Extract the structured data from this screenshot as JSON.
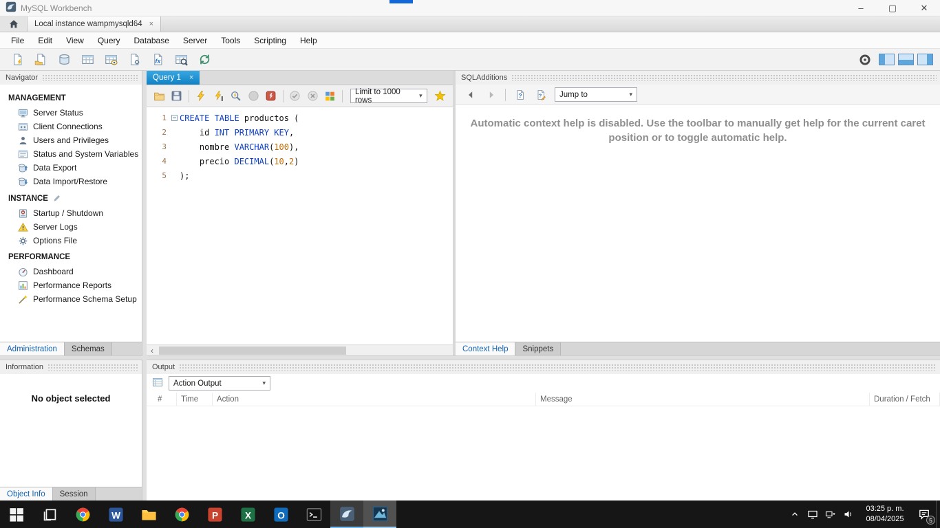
{
  "colors": {
    "query_tab_blue": "#1b86c8",
    "keyword_blue": "#0c3fc4",
    "number_orange": "#c06a00",
    "taskbar_dark": "#161616",
    "active_tab_text_blue": "#1464b4"
  },
  "titlebar": {
    "title": "MySQL Workbench",
    "minimize": "–",
    "maximize": "▢",
    "close": "✕"
  },
  "connection_bar": {
    "tab_label": "Local instance wampmysqld64",
    "tab_close": "×"
  },
  "menu": {
    "items": [
      "File",
      "Edit",
      "View",
      "Query",
      "Database",
      "Server",
      "Tools",
      "Scripting",
      "Help"
    ]
  },
  "main_toolbar": {
    "left_items": [
      "new-sql-tab",
      "open-sql-script",
      "create-schema",
      "create-table",
      "create-view",
      "create-procedure",
      "create-function",
      "search-table-data",
      "reconnect-dbms"
    ],
    "right_status_icon": "connection-status",
    "panel_toggles": [
      "toggle-left-sidebar",
      "toggle-output-area",
      "toggle-secondary-sidebar"
    ]
  },
  "navigator": {
    "header": "Navigator",
    "sections": [
      {
        "title": "MANAGEMENT",
        "items": [
          {
            "label": "Server Status",
            "icon": "server-status"
          },
          {
            "label": "Client Connections",
            "icon": "client-connections"
          },
          {
            "label": "Users and Privileges",
            "icon": "users-privileges"
          },
          {
            "label": "Status and System Variables",
            "icon": "system-variables"
          },
          {
            "label": "Data Export",
            "icon": "data-export"
          },
          {
            "label": "Data Import/Restore",
            "icon": "data-import"
          }
        ]
      },
      {
        "title": "INSTANCE",
        "title_icon": "instance-edit",
        "items": [
          {
            "label": "Startup / Shutdown",
            "icon": "startup-shutdown"
          },
          {
            "label": "Server Logs",
            "icon": "server-logs"
          },
          {
            "label": "Options File",
            "icon": "options-file"
          }
        ]
      },
      {
        "title": "PERFORMANCE",
        "items": [
          {
            "label": "Dashboard",
            "icon": "dashboard"
          },
          {
            "label": "Performance Reports",
            "icon": "performance-reports"
          },
          {
            "label": "Performance Schema Setup",
            "icon": "performance-schema-setup"
          }
        ]
      }
    ],
    "tabs": [
      {
        "label": "Administration",
        "active": true
      },
      {
        "label": "Schemas",
        "active": false
      }
    ]
  },
  "information": {
    "header": "Information",
    "message": "No object selected",
    "tabs": [
      {
        "label": "Object Info",
        "active": true
      },
      {
        "label": "Session",
        "active": false
      }
    ]
  },
  "editor": {
    "tab_label": "Query 1",
    "tab_close": "×",
    "toolbar": {
      "items": [
        "open-script",
        "save-script",
        "|",
        "execute-statements",
        "execute-current-statement",
        "explain-statement",
        "stop-execution",
        "toggle-stop-on-error",
        "|",
        "commit-transaction",
        "rollback-transaction",
        "toggle-autocommit",
        "|",
        "limit-select",
        "save-snippet"
      ],
      "limit_value": "Limit to 1000 rows"
    },
    "code": [
      {
        "n": "1",
        "fold": "minus",
        "tokens": [
          {
            "t": "kw",
            "s": "CREATE TABLE"
          },
          {
            "t": "pl",
            "s": " productos ("
          }
        ]
      },
      {
        "n": "2",
        "fold": "line",
        "tokens": [
          {
            "t": "pl",
            "s": "    id "
          },
          {
            "t": "kw",
            "s": "INT PRIMARY KEY"
          },
          {
            "t": "pl",
            "s": ","
          }
        ]
      },
      {
        "n": "3",
        "fold": "line",
        "tokens": [
          {
            "t": "pl",
            "s": "    nombre "
          },
          {
            "t": "kw",
            "s": "VARCHAR"
          },
          {
            "t": "pl",
            "s": "("
          },
          {
            "t": "nu",
            "s": "100"
          },
          {
            "t": "pl",
            "s": "),"
          }
        ]
      },
      {
        "n": "4",
        "fold": "line",
        "tokens": [
          {
            "t": "pl",
            "s": "    precio "
          },
          {
            "t": "kw",
            "s": "DECIMAL"
          },
          {
            "t": "pl",
            "s": "("
          },
          {
            "t": "nu",
            "s": "10"
          },
          {
            "t": "pl",
            "s": ","
          },
          {
            "t": "nu",
            "s": "2"
          },
          {
            "t": "pl",
            "s": ")"
          }
        ]
      },
      {
        "n": "5",
        "fold": "end",
        "tokens": [
          {
            "t": "pl",
            "s": ");"
          }
        ]
      }
    ]
  },
  "sql_additions": {
    "header": "SQLAdditions",
    "toolbar": {
      "items": [
        "history-back",
        "history-forward",
        "|",
        "manual-context-help",
        "toggle-automatic-help",
        "jump-select"
      ],
      "jump_to_label": "Jump to"
    },
    "help_text": "Automatic context help is disabled. Use the toolbar to manually get help for the current caret position or to toggle automatic help.",
    "tabs": [
      {
        "label": "Context Help",
        "active": true
      },
      {
        "label": "Snippets",
        "active": false
      }
    ]
  },
  "output": {
    "header": "Output",
    "icon": "output-list",
    "view_selector": "Action Output",
    "columns": [
      "#",
      "Time",
      "Action",
      "Message",
      "Duration / Fetch"
    ]
  },
  "taskbar": {
    "apps": [
      {
        "name": "start-button",
        "icon": "start"
      },
      {
        "name": "task-view-button",
        "icon": "task-view"
      },
      {
        "name": "taskbar-chrome",
        "icon": "chrome"
      },
      {
        "name": "taskbar-word",
        "icon": "word"
      },
      {
        "name": "taskbar-file-explorer",
        "icon": "folder"
      },
      {
        "name": "taskbar-chrome-secondary",
        "icon": "chrome"
      },
      {
        "name": "taskbar-powerpoint",
        "icon": "powerpoint"
      },
      {
        "name": "taskbar-excel",
        "icon": "excel"
      },
      {
        "name": "taskbar-outlook",
        "icon": "outlook"
      },
      {
        "name": "taskbar-command-prompt",
        "icon": "cmd"
      },
      {
        "name": "taskbar-mysql-workbench",
        "icon": "workbench",
        "active": true
      },
      {
        "name": "taskbar-capture-tool",
        "icon": "capture",
        "focused": true
      }
    ],
    "tray": {
      "icons": [
        "hidden-icons-chevron",
        "display",
        "network",
        "volume"
      ],
      "time": "03:25 p. m.",
      "date": "08/04/2025",
      "notification_badge": "5"
    }
  }
}
